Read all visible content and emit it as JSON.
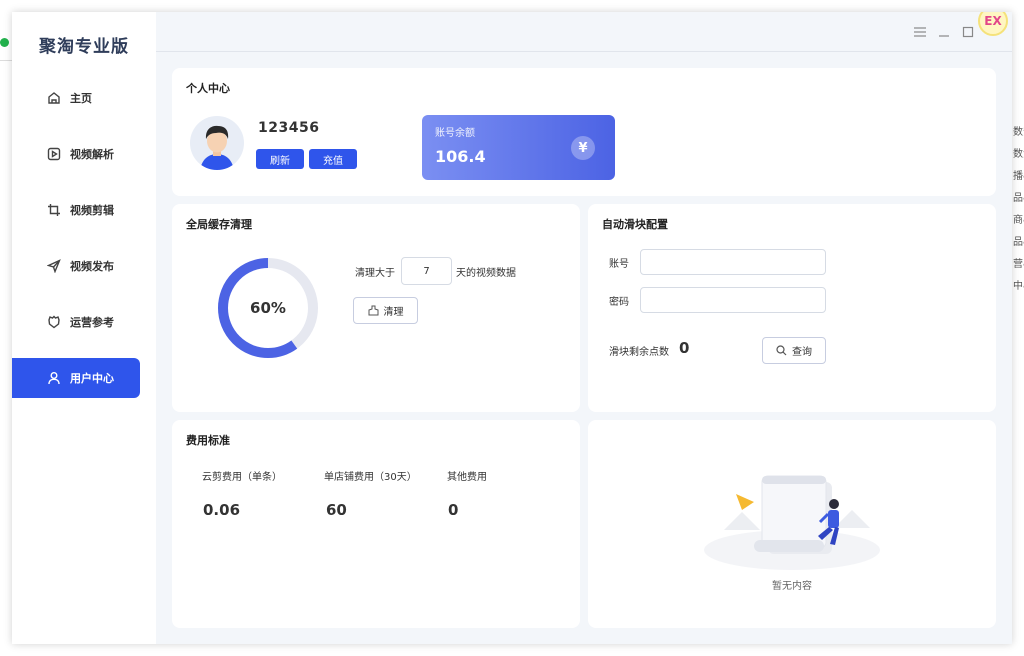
{
  "app": {
    "title": "聚淘专业版"
  },
  "nav": [
    {
      "label": "主页",
      "icon": "home-icon"
    },
    {
      "label": "视频解析",
      "icon": "video-play-icon"
    },
    {
      "label": "视频剪辑",
      "icon": "crop-icon"
    },
    {
      "label": "视频发布",
      "icon": "send-icon"
    },
    {
      "label": "运营参考",
      "icon": "reference-icon"
    },
    {
      "label": "用户中心",
      "icon": "user-icon",
      "active": true
    }
  ],
  "window_controls": [
    "menu-icon",
    "minimize-icon",
    "maximize-icon"
  ],
  "ex_badge": "EX",
  "profile": {
    "title": "个人中心",
    "username": "123456",
    "refresh_label": "刷新",
    "recharge_label": "充值",
    "balance_label": "账号余额",
    "balance_value": "106.4",
    "balance_icon": "¥"
  },
  "cache": {
    "title": "全局缓存清理",
    "percent": 60,
    "percent_label": "60%",
    "clean_prefix": "清理大于",
    "days_value": "7",
    "clean_suffix": "天的视频数据",
    "clean_button": "清理"
  },
  "slider": {
    "title": "自动滑块配置",
    "account_label": "账号",
    "account_value": "",
    "password_label": "密码",
    "password_value": "",
    "remaining_label": "滑块剩余点数",
    "remaining_value": "0",
    "query_button": "查询"
  },
  "fees": {
    "title": "费用标准",
    "items": [
      {
        "label": "云剪费用（单条）",
        "value": "0.06"
      },
      {
        "label": "单店铺费用（30天）",
        "value": "60"
      },
      {
        "label": "其他费用",
        "value": "0"
      }
    ]
  },
  "empty": {
    "text": "暂无内容"
  },
  "background_fragments": [
    "数安",
    "数注",
    "播&",
    "品&",
    "商&",
    "品&",
    "营&",
    "中&"
  ],
  "colors": {
    "accent": "#2f55eb",
    "donut_track": "#e6e8f0",
    "balance_from": "#7b8ff2",
    "balance_to": "#4c63e4"
  }
}
